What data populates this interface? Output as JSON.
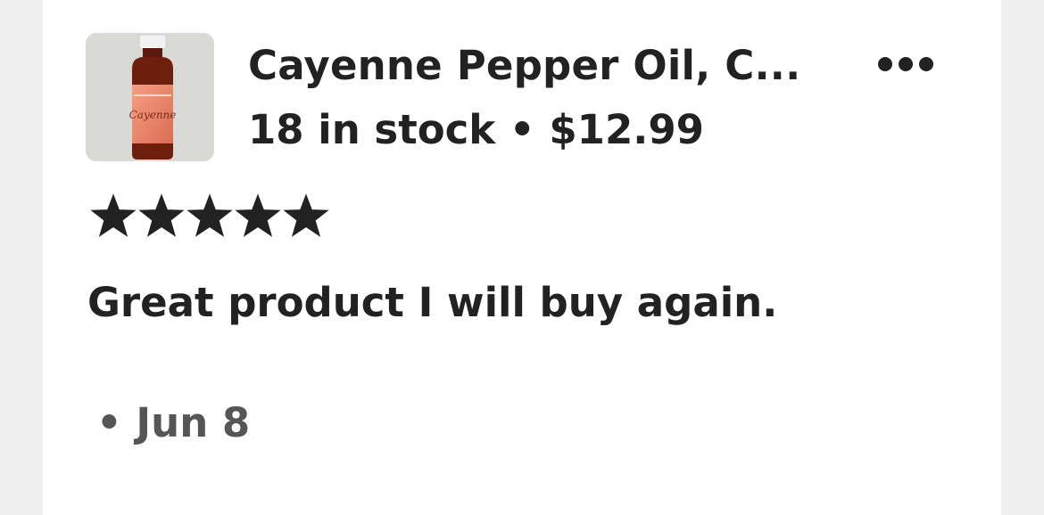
{
  "listing": {
    "image_icon": "product-thumbnail",
    "image_label_text": "Cayenne",
    "title": "Cayenne Pepper Oil, C...",
    "stock": "18 in stock",
    "separator": "•",
    "price": "$12.99",
    "more_icon": "more-horizontal-icon"
  },
  "review": {
    "rating": 5,
    "rating_max": 5,
    "text": "Great product I will buy again.",
    "date": "• Jun 8"
  },
  "colors": {
    "text": "#222222",
    "muted": "#555555",
    "background": "#efefef",
    "card": "#ffffff"
  }
}
